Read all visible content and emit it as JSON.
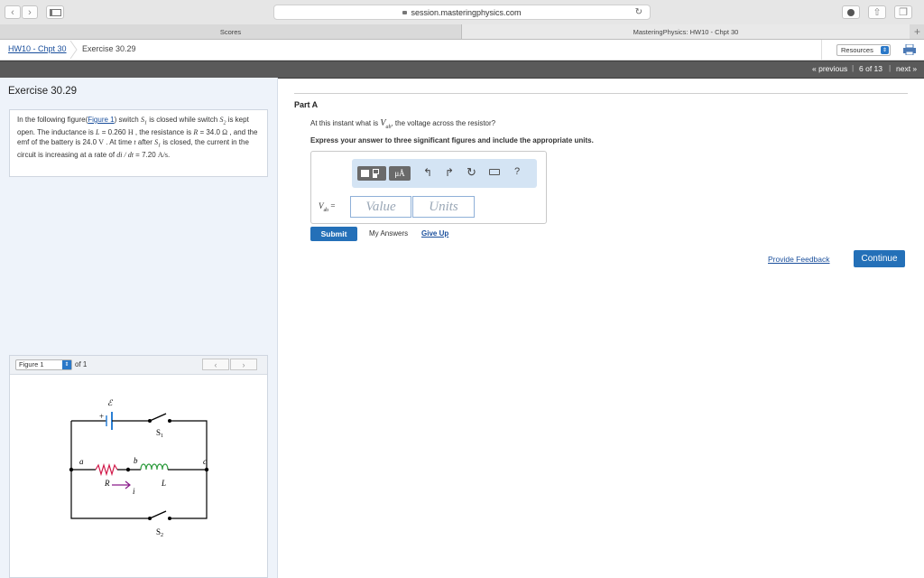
{
  "browser": {
    "url": "session.masteringphysics.com"
  },
  "tabs": [
    {
      "label": "Scores"
    },
    {
      "label": "MasteringPhysics: HW10 - Chpt 30"
    }
  ],
  "header": {
    "breadcrumb_link": "HW10 - Chpt 30",
    "breadcrumb_current": "Exercise 30.29",
    "resources_label": "Resources"
  },
  "nav": {
    "previous": "« previous",
    "position": "6 of 13",
    "next": "next »"
  },
  "problem": {
    "title": "Exercise 30.29",
    "text_intro": "In the following figure(",
    "figure_link": "Figure 1",
    "text_1": ") switch ",
    "s1": "S",
    "s1_sub": "1",
    "text_2": " is closed while switch ",
    "s2": "S",
    "s2_sub": "2",
    "text_3": " is kept open. The inductance is ",
    "L_sym": "L",
    "text_4": " = 0.260 ",
    "L_unit": "H",
    "text_5": " , the resistance is ",
    "R_sym": "R",
    "text_6": " = 34.0 ",
    "R_unit": "Ω",
    "text_7": " , and the emf of the battery is 24.0 ",
    "V_unit": "V",
    "text_8": " . At time ",
    "t_sym": "t",
    "text_9": " after ",
    "text_10": " is closed, the current in the circuit is increasing at a rate of ",
    "rate_expr": "di / dt",
    "text_11": " = 7.20 ",
    "rate_unit": "A/s",
    "text_12": "."
  },
  "figure": {
    "select_value": "Figure 1",
    "of_label": "of 1",
    "labels": {
      "emf": "ℰ",
      "plus": "+",
      "s1": "S",
      "s1_sub": "1",
      "s2": "S",
      "s2_sub": "2",
      "a": "a",
      "b": "b",
      "c": "c",
      "R": "R",
      "L": "L",
      "i": "i"
    }
  },
  "partA": {
    "title": "Part A",
    "question_pre": "At this instant what is ",
    "v_sym": "V",
    "v_sub": "ab",
    "question_post": ", the voltage across the resistor?",
    "instruction": "Express your answer to three significant figures and include the appropriate units.",
    "toolbar_mu": "μÅ",
    "toolbar_help": "?",
    "answer_label_sym": "V",
    "answer_label_sub": "ab",
    "answer_label_eq": " =",
    "value_placeholder": "Value",
    "units_placeholder": "Units",
    "submit_label": "Submit",
    "my_answers_label": "My Answers",
    "give_up_label": "Give Up"
  },
  "footer": {
    "feedback_label": "Provide Feedback",
    "continue_label": "Continue"
  }
}
